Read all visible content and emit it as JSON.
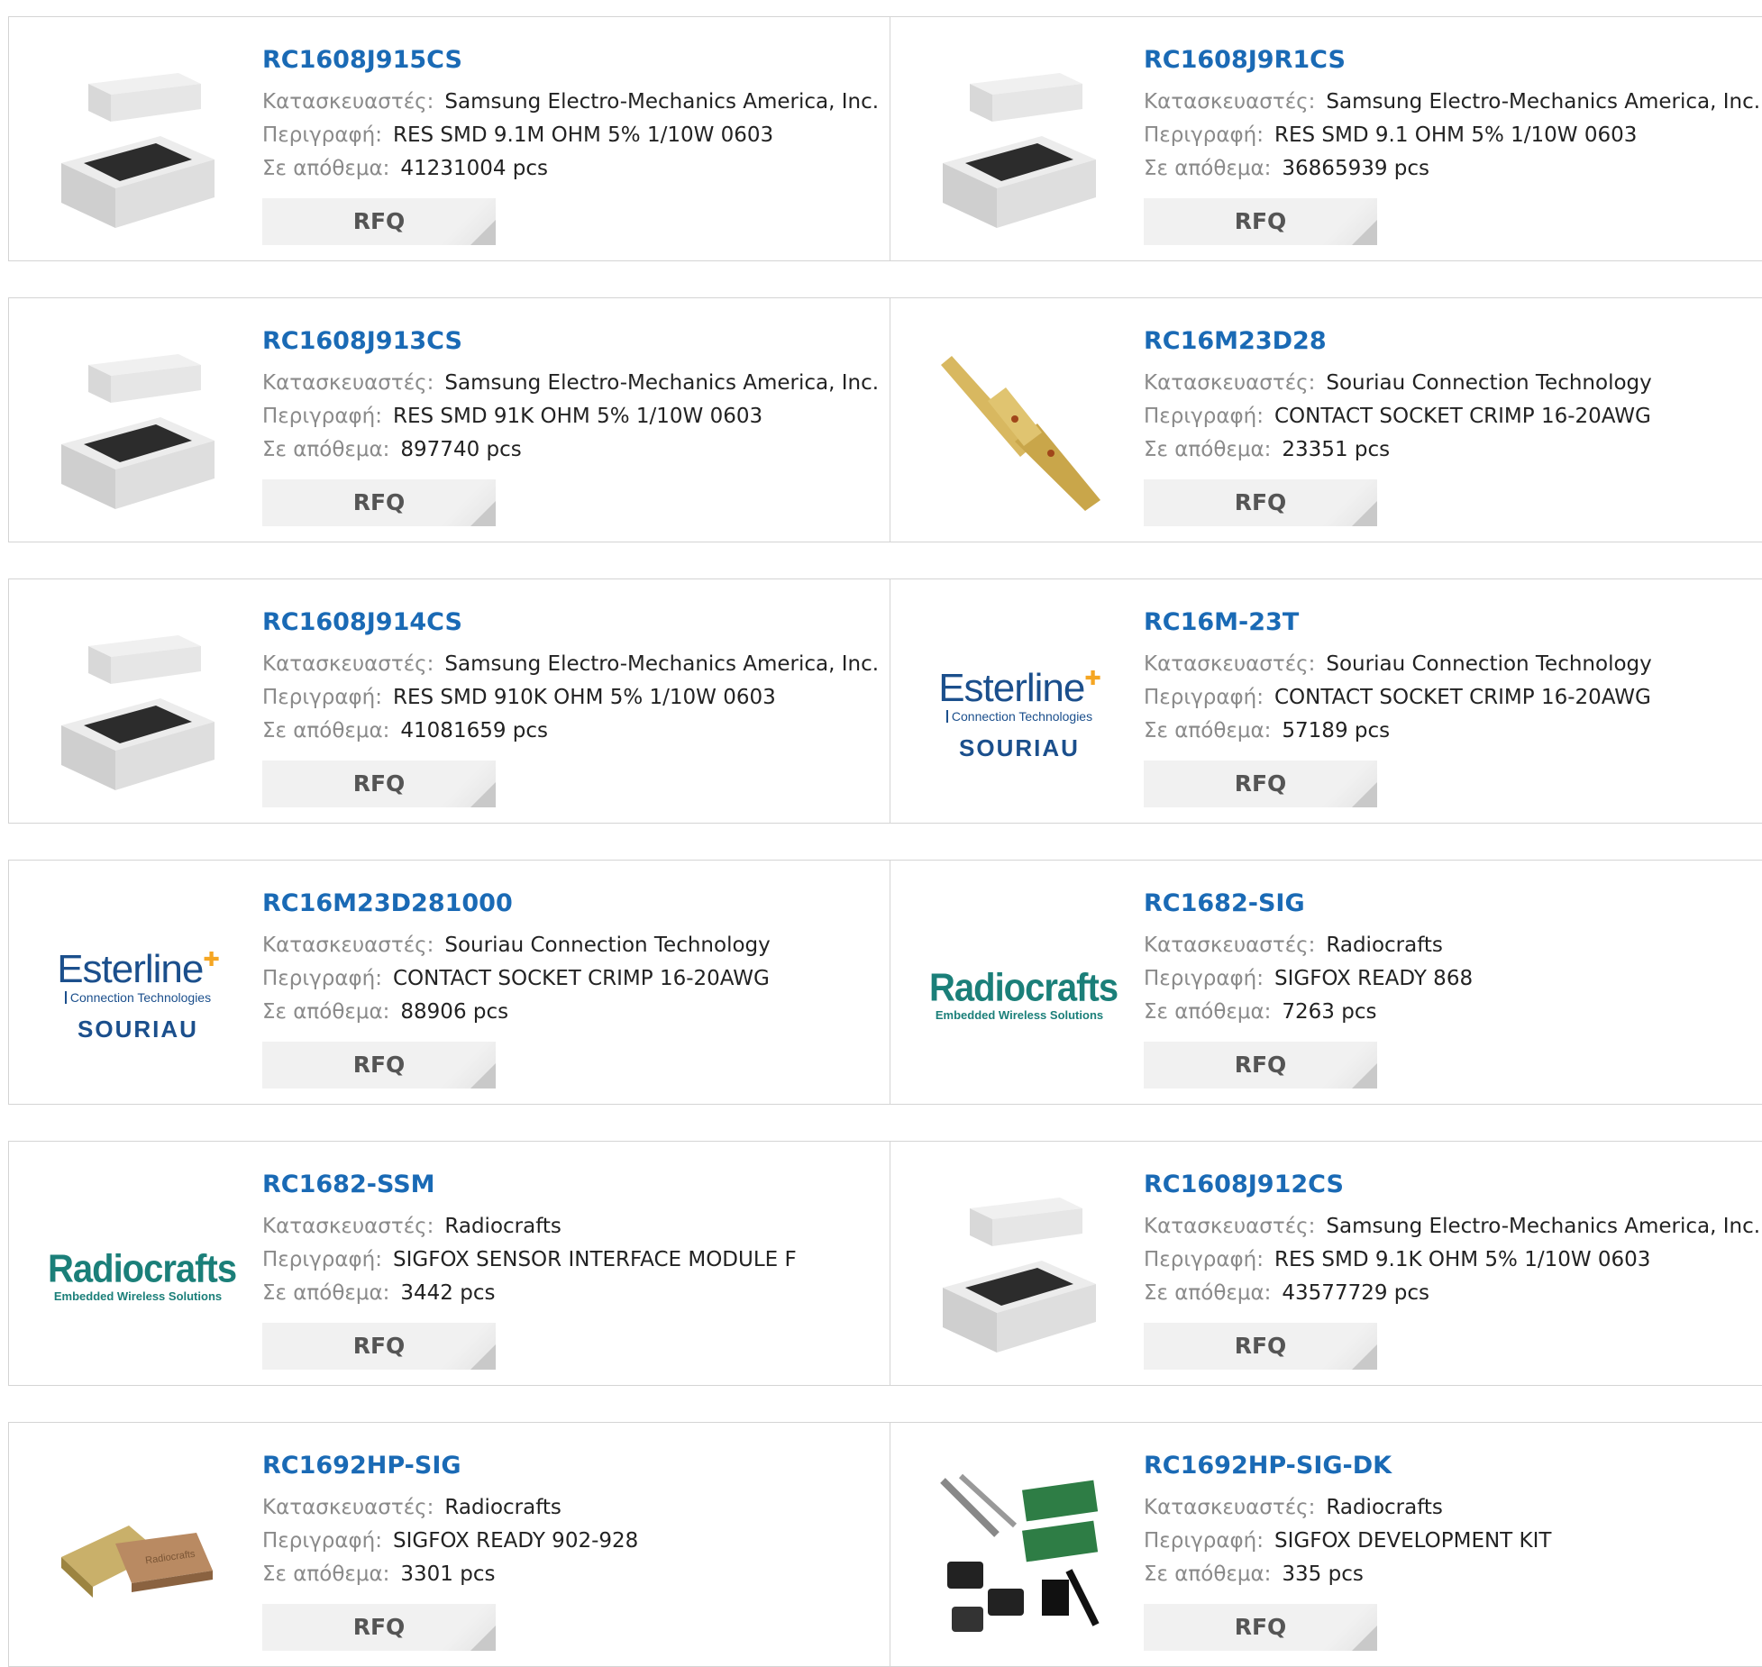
{
  "labels": {
    "manufacturer": "Κατασκευαστές:",
    "description": "Περιγραφή:",
    "stock": "Σε απόθεμα:",
    "rfq": "RFQ"
  },
  "products": [
    {
      "part": "RC1608J915CS",
      "manufacturer": "Samsung Electro-Mechanics America, Inc.",
      "description": "RES SMD 9.1M OHM 5% 1/10W 0603",
      "stock": "41231004 pcs",
      "image": "chip-resistor"
    },
    {
      "part": "RC1608J9R1CS",
      "manufacturer": "Samsung Electro-Mechanics America, Inc.",
      "description": "RES SMD 9.1 OHM 5% 1/10W 0603",
      "stock": "36865939 pcs",
      "image": "chip-resistor"
    },
    {
      "part": "RC1608J913CS",
      "manufacturer": "Samsung Electro-Mechanics America, Inc.",
      "description": "RES SMD 91K OHM 5% 1/10W 0603",
      "stock": "897740 pcs",
      "image": "chip-resistor"
    },
    {
      "part": "RC16M23D28",
      "manufacturer": "Souriau Connection Technology",
      "description": "CONTACT SOCKET CRIMP 16-20AWG",
      "stock": "23351 pcs",
      "image": "crimp-contact"
    },
    {
      "part": "RC1608J914CS",
      "manufacturer": "Samsung Electro-Mechanics America, Inc.",
      "description": "RES SMD 910K OHM 5% 1/10W 0603",
      "stock": "41081659 pcs",
      "image": "chip-resistor"
    },
    {
      "part": "RC16M-23T",
      "manufacturer": "Souriau Connection Technology",
      "description": "CONTACT SOCKET CRIMP 16-20AWG",
      "stock": "57189 pcs",
      "image": "esterline-logo"
    },
    {
      "part": "RC16M23D281000",
      "manufacturer": "Souriau Connection Technology",
      "description": "CONTACT SOCKET CRIMP 16-20AWG",
      "stock": "88906 pcs",
      "image": "esterline-logo"
    },
    {
      "part": "RC1682-SIG",
      "manufacturer": "Radiocrafts",
      "description": "SIGFOX READY 868",
      "stock": "7263 pcs",
      "image": "radiocrafts-logo"
    },
    {
      "part": "RC1682-SSM",
      "manufacturer": "Radiocrafts",
      "description": "SIGFOX SENSOR INTERFACE MODULE F",
      "stock": "3442 pcs",
      "image": "radiocrafts-logo"
    },
    {
      "part": "RC1608J912CS",
      "manufacturer": "Samsung Electro-Mechanics America, Inc.",
      "description": "RES SMD 9.1K OHM 5% 1/10W 0603",
      "stock": "43577729 pcs",
      "image": "chip-resistor"
    },
    {
      "part": "RC1692HP-SIG",
      "manufacturer": "Radiocrafts",
      "description": "SIGFOX READY 902-928",
      "stock": "3301 pcs",
      "image": "rf-module"
    },
    {
      "part": "RC1692HP-SIG-DK",
      "manufacturer": "Radiocrafts",
      "description": "SIGFOX DEVELOPMENT KIT",
      "stock": "335 pcs",
      "image": "dev-kit"
    }
  ],
  "logos": {
    "esterline": {
      "name": "Esterline",
      "sub": "Connection Technologies",
      "brand": "SOURIAU"
    },
    "radiocrafts": {
      "name": "Radiocrafts",
      "sub": "Embedded Wireless Solutions",
      "module_text": "Radiocrafts"
    }
  },
  "colors": {
    "link": "#1a6ab5",
    "label": "#8a8a8a",
    "value": "#222222",
    "rfq_bg": "#f1f1f1",
    "border": "#d4d4d4"
  }
}
